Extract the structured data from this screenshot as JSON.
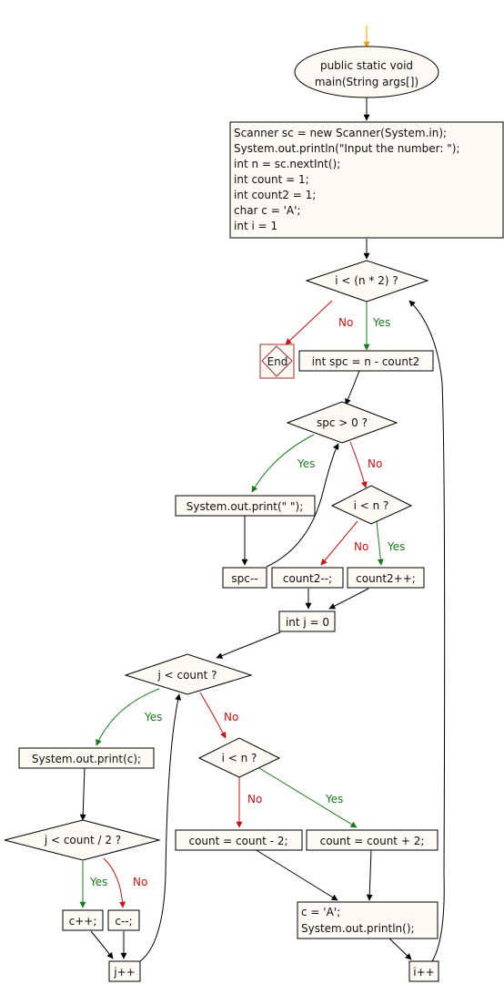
{
  "colors": {
    "node_fill": "#fdf9f3",
    "yes": "#1a7a1a",
    "no": "#cc1111",
    "start_arrow": "#f5a000",
    "end_border": "#a03030"
  },
  "labels": {
    "yes": "Yes",
    "no": "No"
  },
  "nodes": {
    "start": {
      "lines": [
        "public static void",
        "main(String args[])"
      ]
    },
    "init": {
      "lines": [
        "Scanner sc = new Scanner(System.in);",
        "System.out.println(\"Input the number: \");",
        "int n = sc.nextInt();",
        "int count = 1;",
        "int count2 = 1;",
        "char c = 'A';",
        "int i = 1"
      ]
    },
    "cond_outer": "i < (n * 2) ?",
    "end": "End",
    "spc_init": "int spc = n - count2",
    "cond_spc": "spc > 0 ?",
    "print_space": "System.out.print(\" \");",
    "spc_dec": "spc--",
    "cond_i_n_1": "i < n ?",
    "count2_dec": "count2--;",
    "count2_inc": "count2++;",
    "j_init": "int j = 0",
    "cond_j": "j < count ?",
    "print_c": "System.out.print(c);",
    "cond_j_half": "j < count / 2 ?",
    "c_inc": "c++;",
    "c_dec": "c--;",
    "j_inc": "j++",
    "cond_i_n_2": "i < n ?",
    "count_dec": "count = count - 2;",
    "count_inc": "count = count + 2;",
    "reset": {
      "lines": [
        "c = 'A';",
        "System.out.println();"
      ]
    },
    "i_inc": "i++"
  }
}
